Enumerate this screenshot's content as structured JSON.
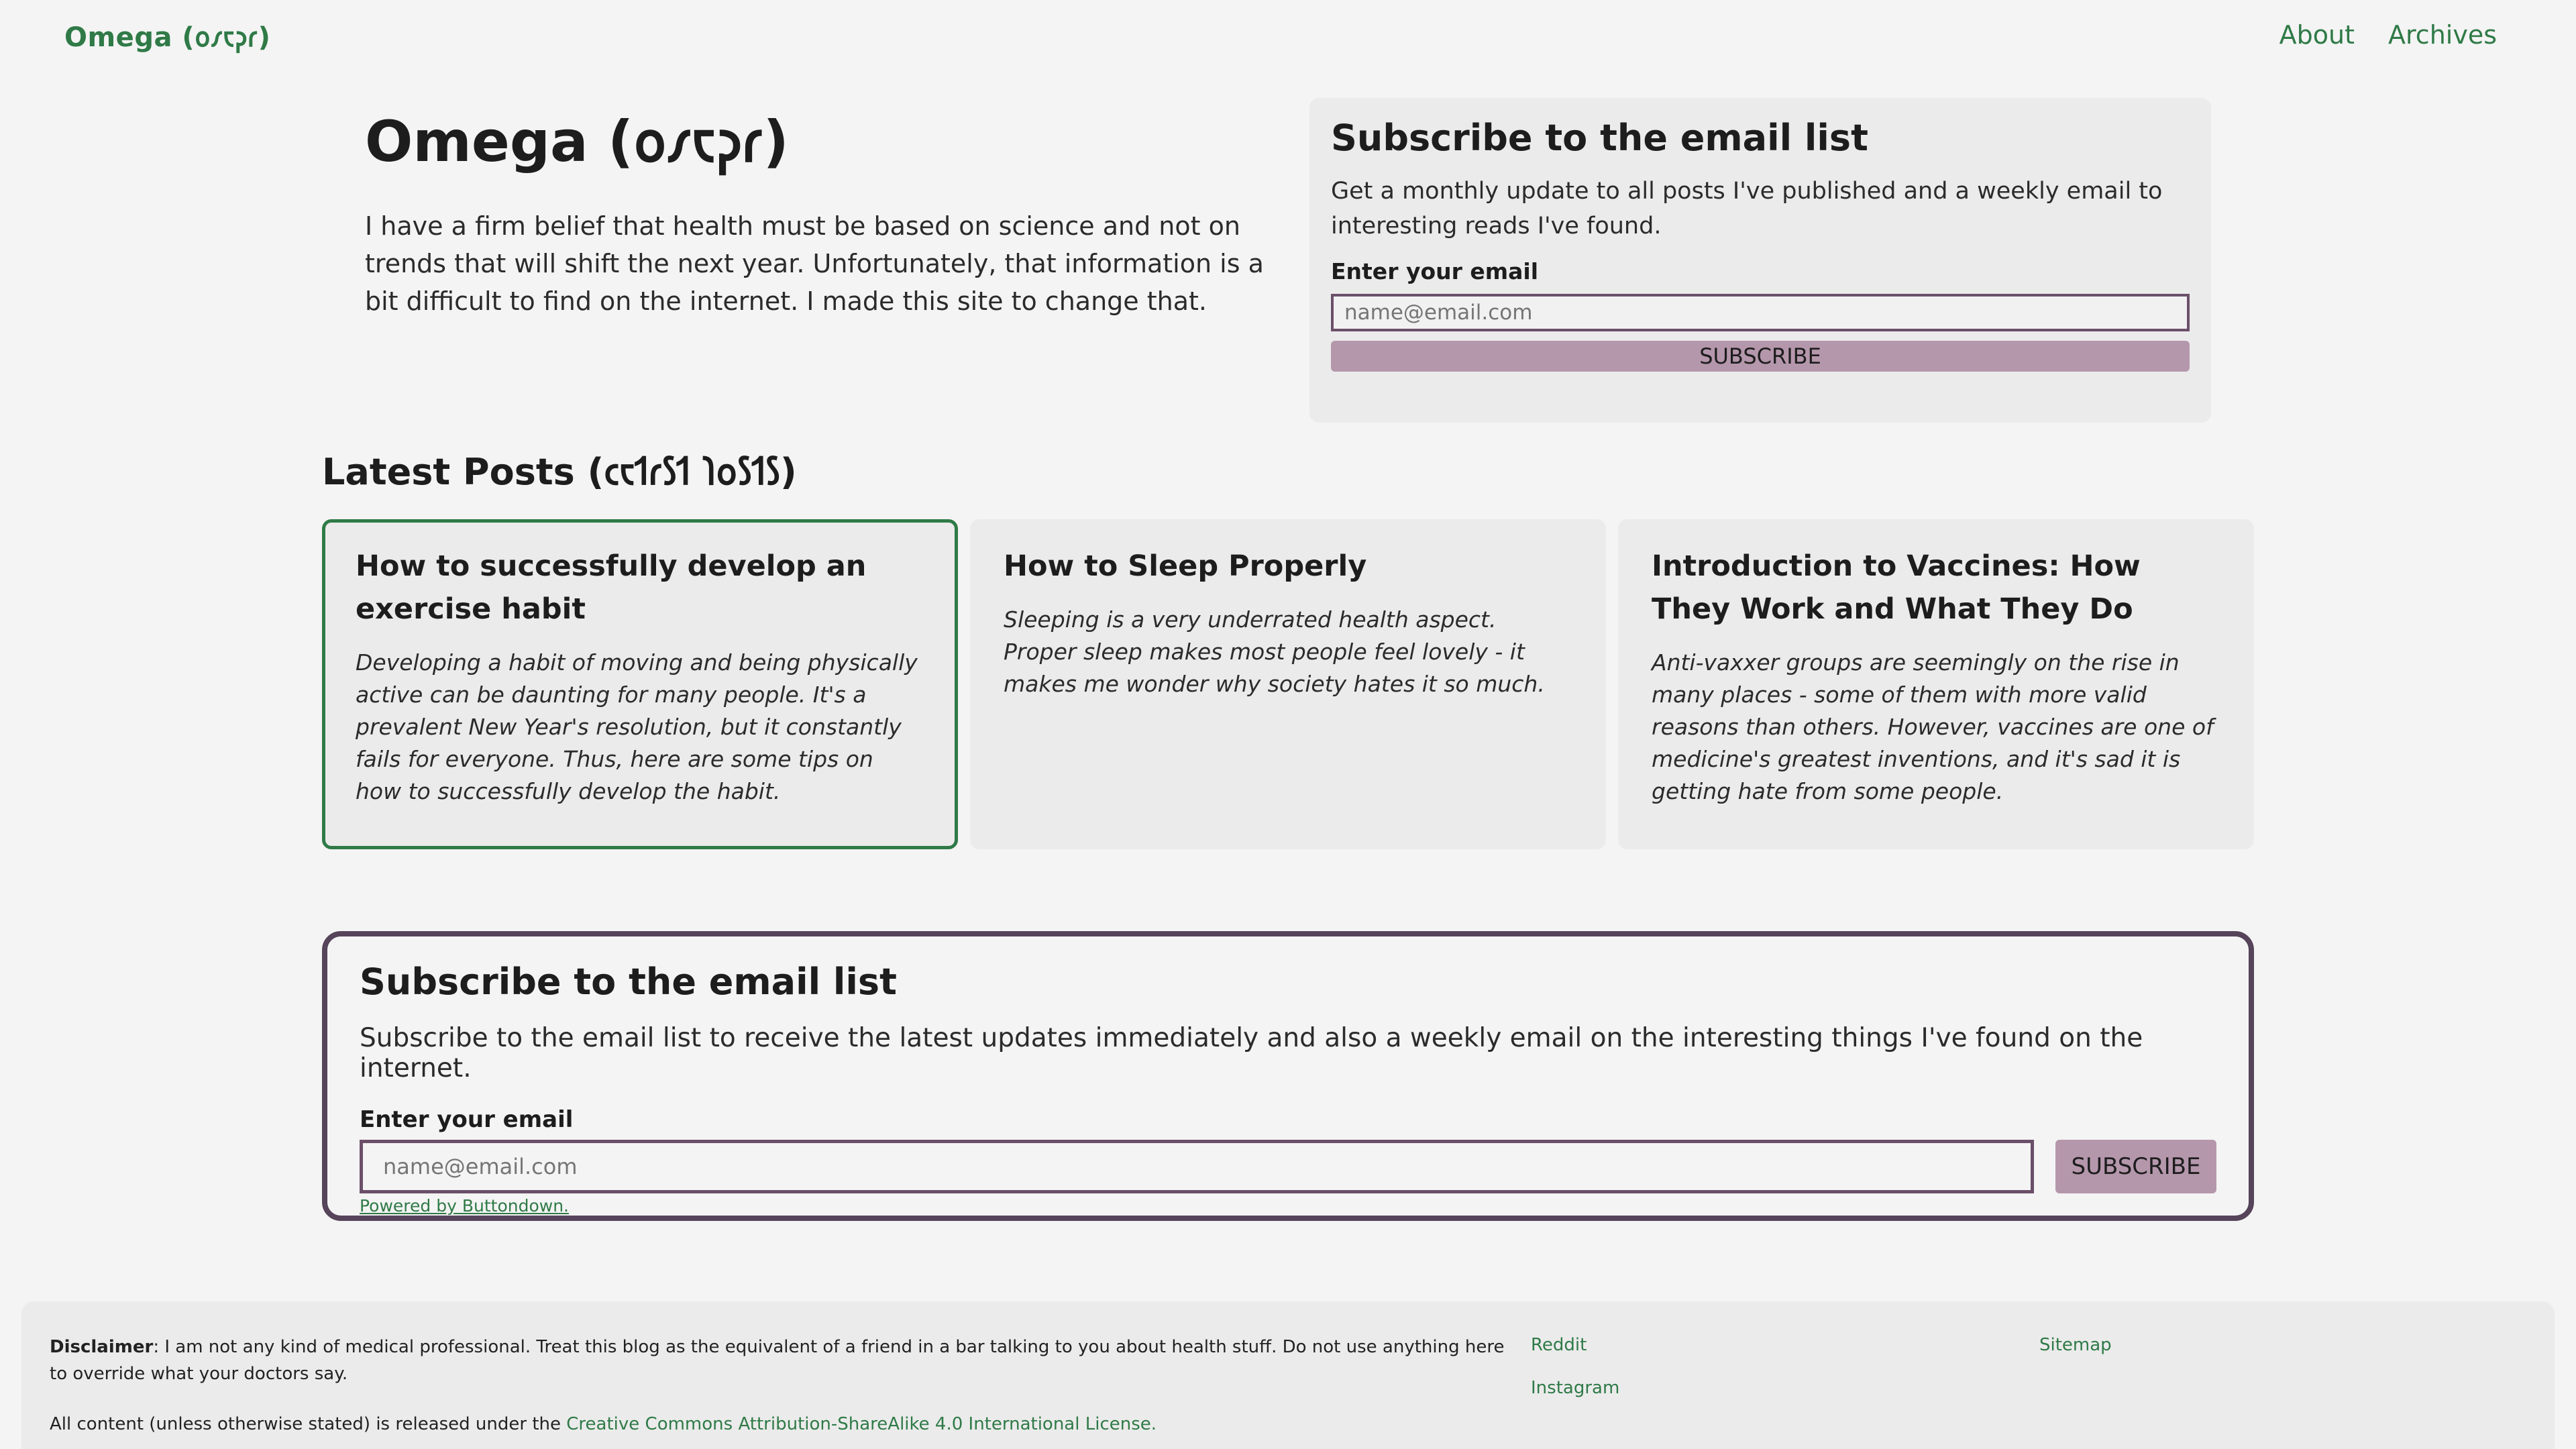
{
  "header": {
    "brand": "Omega (𐑴𐑥𐑱𐑜𐑩)",
    "nav": [
      {
        "label": "About"
      },
      {
        "label": "Archives"
      }
    ]
  },
  "hero": {
    "title": "Omega (𐑴𐑥𐑱𐑜𐑩)",
    "description": "I have a firm belief that health must be based on science and not on trends that will shift the next year. Unfortunately, that information is a bit difficult to find on the internet. I made this site to change that."
  },
  "subscribe_card": {
    "title": "Subscribe to the email list",
    "description": "Get a monthly update to all posts I've published and a weekly email to interesting reads I've found.",
    "email_label": "Enter your email",
    "email_placeholder": "name@email.com",
    "button": "SUBSCRIBE"
  },
  "latest_posts": {
    "title": "Latest Posts (𐑤𐑱𐑑𐑩𐑕𐑑 𐑐𐑴𐑕𐑑𐑕)",
    "posts": [
      {
        "title": "How to successfully develop an exercise habit",
        "excerpt": "Developing a habit of moving and being physically active can be daunting for many people. It's a prevalent New Year's resolution, but it constantly fails for everyone. Thus, here are some tips on how to successfully develop the habit."
      },
      {
        "title": "How to Sleep Properly",
        "excerpt": "Sleeping is a very underrated health aspect. Proper sleep makes most people feel lovely - it makes me wonder why society hates it so much."
      },
      {
        "title": "Introduction to Vaccines: How They Work and What They Do",
        "excerpt": "Anti-vaxxer groups are seemingly on the rise in many places - some of them with more valid reasons than others. However, vaccines are one of medicine's greatest inventions, and it's sad it is getting hate from some people."
      }
    ]
  },
  "subscribe_box": {
    "title": "Subscribe to the email list",
    "description": "Subscribe to the email list to receive the latest updates immediately and also a weekly email on the interesting things I've found on the internet.",
    "email_label": "Enter your email",
    "email_placeholder": "name@email.com",
    "button": "SUBSCRIBE",
    "powered_by": "Powered by Buttondown."
  },
  "footer": {
    "disclaimer_label": "Disclaimer",
    "disclaimer_text": ": I am not any kind of medical professional. Treat this blog as the equivalent of a friend in a bar talking to you about health stuff. Do not use anything here to override what your doctors say.",
    "license_prefix": "All content (unless otherwise stated) is released under the ",
    "license_link": "Creative Commons Attribution-ShareAlike 4.0 International License.",
    "links": {
      "reddit": "Reddit",
      "instagram": "Instagram",
      "sitemap": "Sitemap"
    }
  },
  "colors": {
    "accent_green": "#2f7a47",
    "button_mauve": "#b597ac",
    "border_plum": "#56445a"
  }
}
